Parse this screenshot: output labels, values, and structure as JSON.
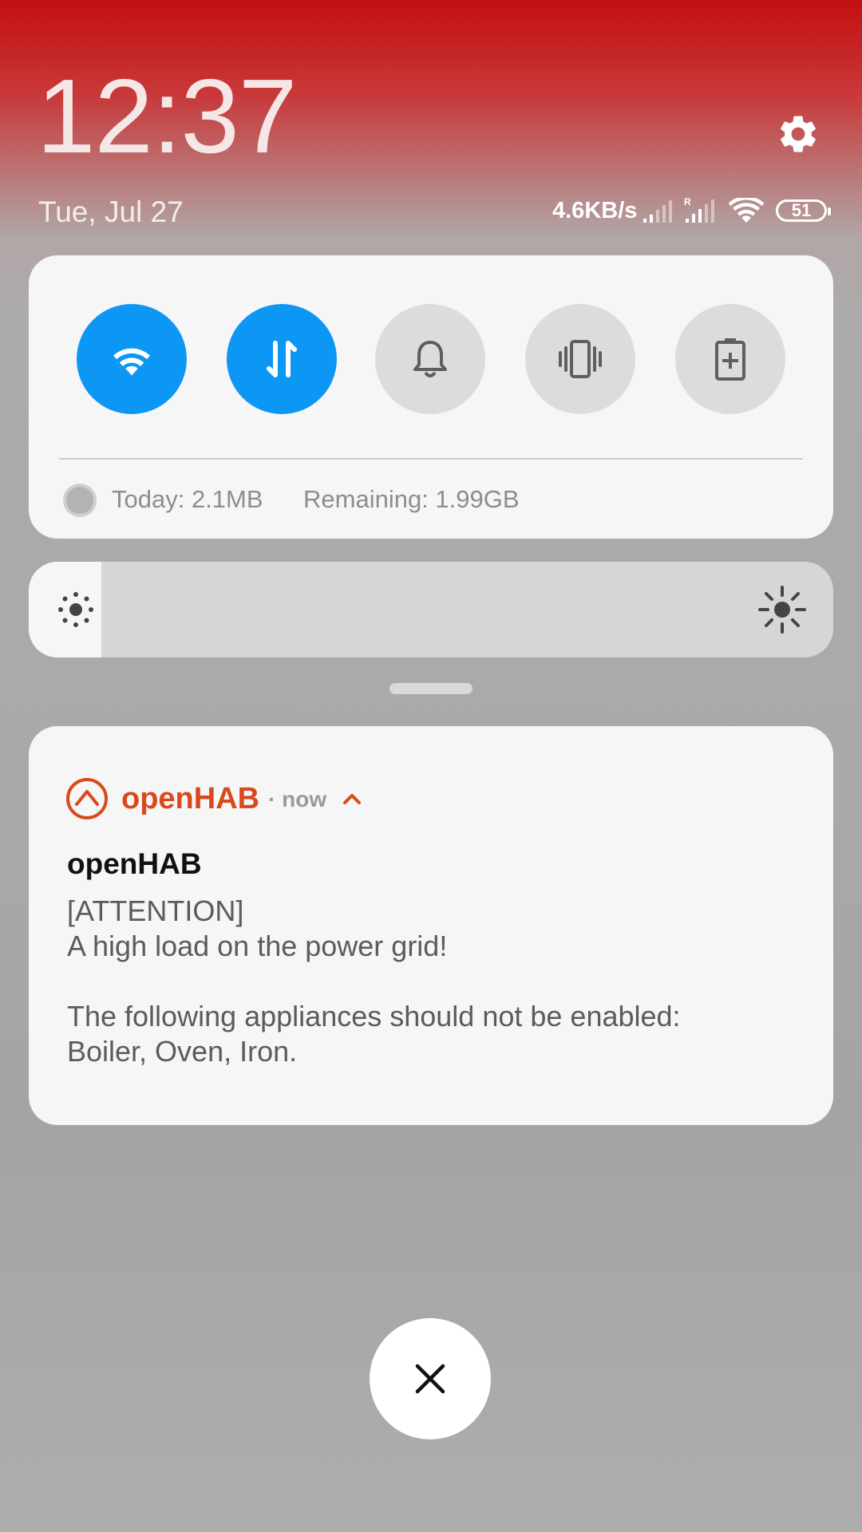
{
  "status_bar": {
    "time": "12:37",
    "date": "Tue, Jul 27",
    "net_speed": "4.6KB/s",
    "roaming_indicator": "R",
    "battery": "51"
  },
  "quick_settings": {
    "tiles": [
      {
        "name": "wifi-icon",
        "active": true
      },
      {
        "name": "mobile-data-icon",
        "active": false
      },
      {
        "name": "bell-icon",
        "active": false
      },
      {
        "name": "vibrate-icon",
        "active": false
      },
      {
        "name": "battery-saver-icon",
        "active": false
      }
    ],
    "data_usage": {
      "today": "Today: 2.1MB",
      "remaining": "Remaining: 1.99GB"
    }
  },
  "brightness": {
    "level": 0.08
  },
  "notification": {
    "app_name": "openHAB",
    "time": "now",
    "title": "openHAB",
    "body": "[ATTENTION]\nA high load on the power grid!\n\nThe following appliances should not be enabled:\nBoiler, Oven, Iron.",
    "accent_color": "#d84a1b"
  },
  "colors": {
    "tile_active": "#0d97f5",
    "tile_inactive": "#dcdcdc"
  }
}
